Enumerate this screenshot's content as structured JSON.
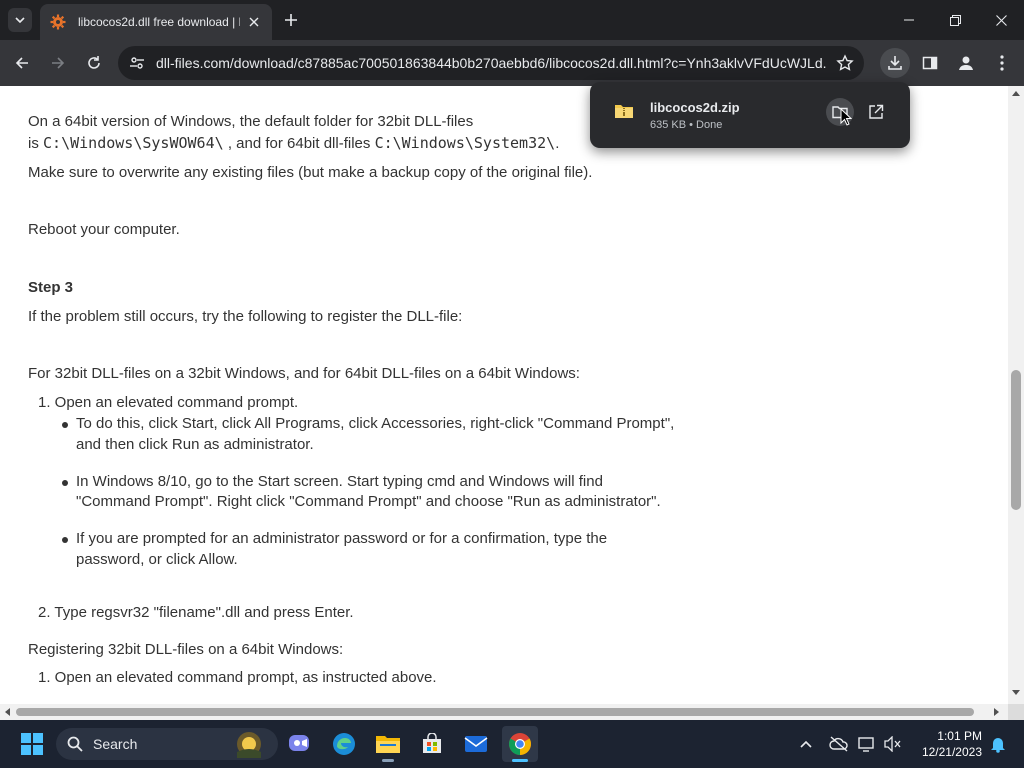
{
  "browser": {
    "tab_title": "libcocos2d.dll free download | D",
    "url": "dll-files.com/download/c87885ac700501863844b0b270aebbd6/libcocos2d.dll.html?c=Ynh3aklvVFdUcWJLd..."
  },
  "download": {
    "filename": "libcocos2d.zip",
    "meta": "635 KB • Done"
  },
  "page": {
    "line1": "On a 64bit version of Windows, the default folder for 32bit DLL-files",
    "line2a": "is",
    "path1": "C:\\Windows\\SysWOW64\\",
    "line2b": ", and for 64bit dll-files",
    "path2": "C:\\Windows\\System32\\",
    "line2c": ".",
    "overwrite": "Make sure to overwrite any existing files (but make a backup copy of the original file).",
    "reboot": "Reboot your computer.",
    "step3": "Step 3",
    "problem": "If the problem still occurs, try the following to register the DLL-file:",
    "for32": "For 32bit DLL-files on a 32bit Windows, and for 64bit DLL-files on a 64bit Windows:",
    "item1": "1. Open an elevated command prompt.",
    "b1a": "To do this, click Start, click All Programs, click Accessories, right-click \"Command Prompt\",",
    "b1b": "and then click Run as administrator.",
    "b2a": "In Windows 8/10, go to the Start screen. Start typing cmd and Windows will find",
    "b2b": "\"Command Prompt\". Right click \"Command Prompt\" and choose \"Run as administrator\".",
    "b3a": "If you are prompted for an administrator password or for a confirmation, type the",
    "b3b": "password, or click Allow.",
    "item2": "2. Type regsvr32 \"filename\".dll and press Enter.",
    "reg64": "Registering 32bit DLL-files on a 64bit Windows:",
    "item1b": "1. Open an elevated command prompt, as instructed above."
  },
  "taskbar": {
    "search_label": "Search",
    "time": "1:01 PM",
    "date": "12/21/2023"
  }
}
